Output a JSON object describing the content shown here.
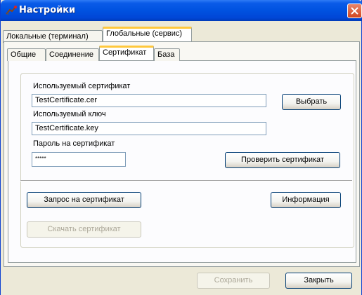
{
  "window": {
    "title": "Настройки"
  },
  "outer_tabs": [
    {
      "label": "Локальные (терминал)"
    },
    {
      "label": "Глобальные (сервис)"
    }
  ],
  "inner_tabs": [
    {
      "label": "Общие"
    },
    {
      "label": "Соединение"
    },
    {
      "label": "Сертификат"
    },
    {
      "label": "База"
    }
  ],
  "certificate": {
    "cert_label": "Используемый сертификат",
    "cert_value": "TestCertificate.cer",
    "key_label": "Используемый ключ",
    "key_value": "TestCertificate.key",
    "password_label": "Пароль на сертификат",
    "password_value": "*****",
    "choose_button": "Выбрать",
    "check_button": "Проверить сертификат",
    "request_button": "Запрос на сертификат",
    "info_button": "Информация",
    "download_button": "Скачать сертификат"
  },
  "footer": {
    "save_button": "Сохранить",
    "close_button": "Закрыть"
  }
}
